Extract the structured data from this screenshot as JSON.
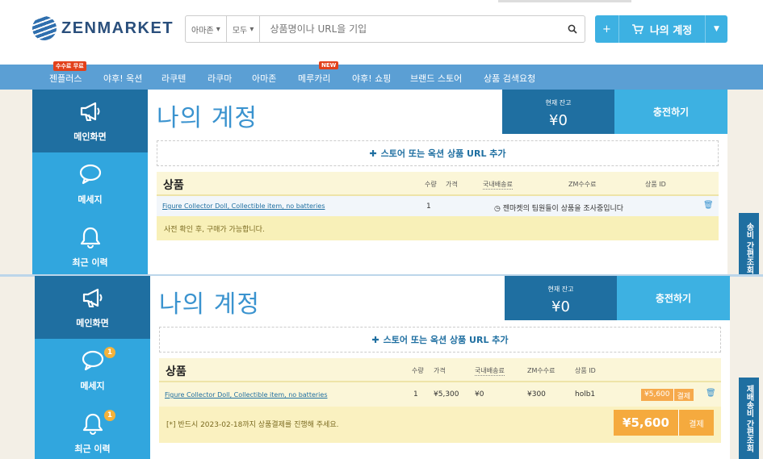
{
  "header": {
    "logo": "ZENMARKET",
    "search_source": "아마존",
    "search_category": "모두",
    "search_placeholder": "상품명이나 URL을 기입",
    "account_label": "나의 계정",
    "account_plus": "+"
  },
  "nav": {
    "items": [
      "젠플러스",
      "야후! 옥션",
      "라쿠텐",
      "라쿠마",
      "아마존",
      "메루카리",
      "야후! 쇼핑",
      "브랜드 스토어",
      "상품 검색요청"
    ],
    "badge_free": "수수료 무료",
    "badge_new": "NEW"
  },
  "sidebar": {
    "items": [
      "메인화면",
      "메세지",
      "최근 이력"
    ],
    "message_badge": "1",
    "history_badge": "1"
  },
  "side_tab": {
    "top": "송비 간편조회",
    "bottom": "제배송비 간편조회"
  },
  "page": {
    "title": "나의 계정",
    "balance_label": "현재 잔고",
    "balance_value": "¥0",
    "charge_button": "충전하기",
    "add_url": "스토어 또는 옥션 상품 URL 추가"
  },
  "table": {
    "heading": "상품",
    "cols": {
      "qty": "수량",
      "price": "가격",
      "domestic": "국내배송료",
      "fee": "ZM수수료",
      "id": "상품 ID"
    }
  },
  "panel1": {
    "product": "Figure Collector Doll, Collectible item, no batteries",
    "qty": "1",
    "status": "젠마켓의 팀원들이 상품을 조사중입니다",
    "notice": "사전 확인 후, 구매가 가능합니다."
  },
  "panel2": {
    "product": "Figure Collector Doll, Collectible item, no batteries",
    "qty": "1",
    "price": "¥5,300",
    "domestic": "¥0",
    "fee": "¥300",
    "product_id": "holb1",
    "row_total": "¥5,600",
    "pay_label": "결제",
    "notice": "[*] 반드시 2023-02-18까지 상품결제를 진행해 주세요.",
    "total": "¥5,600"
  }
}
